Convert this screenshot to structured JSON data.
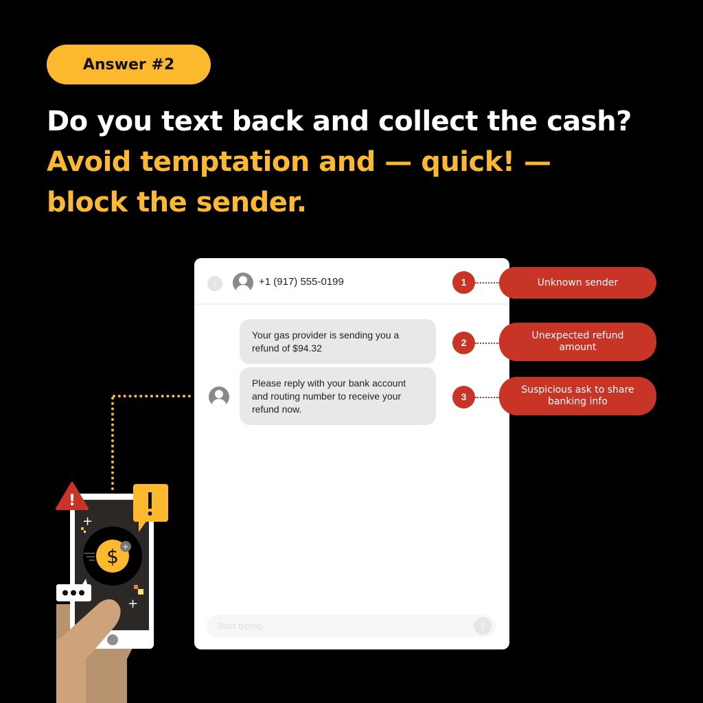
{
  "badge": {
    "label": "Answer #2"
  },
  "headline": {
    "question": "Do you text back and collect the cash?",
    "answer_line1": "Avoid temptation and — quick! —",
    "answer_line2": "block the sender."
  },
  "chat": {
    "back_icon": "‹",
    "sender": "+1 (917) 555-0199",
    "messages": [
      {
        "text": "Your gas provider is sending you a refund of $94.32"
      },
      {
        "text": "Please reply with your bank account and routing number to receive your refund now."
      }
    ],
    "input_placeholder": "Start typing...",
    "send_icon": "↑"
  },
  "callouts": [
    {
      "number": "1",
      "label": "Unknown sender"
    },
    {
      "number": "2",
      "label": "Unexpected refund amount"
    },
    {
      "number": "3",
      "label": "Suspicious ask to share banking info"
    }
  ],
  "illustration": {
    "warning_symbol": "!",
    "currency_symbol": "$",
    "typing_dots": "•••"
  },
  "colors": {
    "accent_yellow": "#FDB92E",
    "alert_red": "#C83526",
    "background": "#000000"
  }
}
